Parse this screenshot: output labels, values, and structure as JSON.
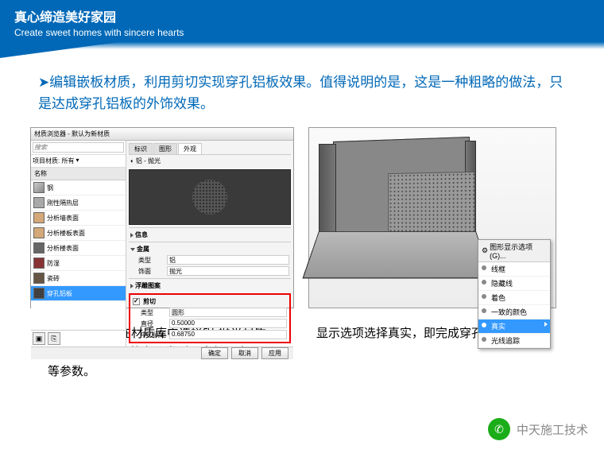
{
  "banner": {
    "cn": "真心缔造美好家园",
    "en": "Create sweet homes with sincere hearts"
  },
  "desc": "➤编辑嵌板材质，利用剪切实现穿孔铝板效果。值得说明的是，这是一种粗略的做法，只是达成穿孔铝板的外饰效果。",
  "dialog": {
    "title": "材质浏览器 - 默认为新材质",
    "search": "搜索",
    "filter_label": "项目材质: 所有",
    "col_name": "名称",
    "materials": [
      "钢",
      "刚性隔热层",
      "分析墙表面",
      "分析楼板表面",
      "分析楼表面",
      "防湿",
      "瓷砖",
      "穿孔铝板"
    ],
    "tabs": [
      "标识",
      "图形",
      "外观"
    ],
    "preview_name": "铝 - 抛光",
    "sections": {
      "info": "信息",
      "metal": "金属",
      "float": "浮雕图案",
      "cut": "剪切"
    },
    "metal_rows": {
      "type_label": "类型",
      "type_value": "铝",
      "finish_label": "饰面",
      "finish_value": "抛光"
    },
    "cut_rows": {
      "type_label": "类型",
      "type_value": "圆形",
      "diameter_label": "直径",
      "diameter_value": "0.50000",
      "spacing_label": "中心间距",
      "spacing_value": "0.68750"
    },
    "buttons": {
      "ok": "确定",
      "cancel": "取消",
      "apply": "应用"
    }
  },
  "context": {
    "header": "图形显示选项(G)...",
    "items": [
      "线框",
      "隐藏线",
      "着色",
      "一致的颜色",
      "真实",
      "光线追踪"
    ]
  },
  "captions": {
    "left": "创建新材质，在材质库中选择铝-抛光材质。点击[剪切],可调整穿孔类型，直径即中心间距等参数。",
    "right": "显示选项选择真实，即完成穿孔铝板创建。"
  },
  "watermark": "中天施工技术"
}
